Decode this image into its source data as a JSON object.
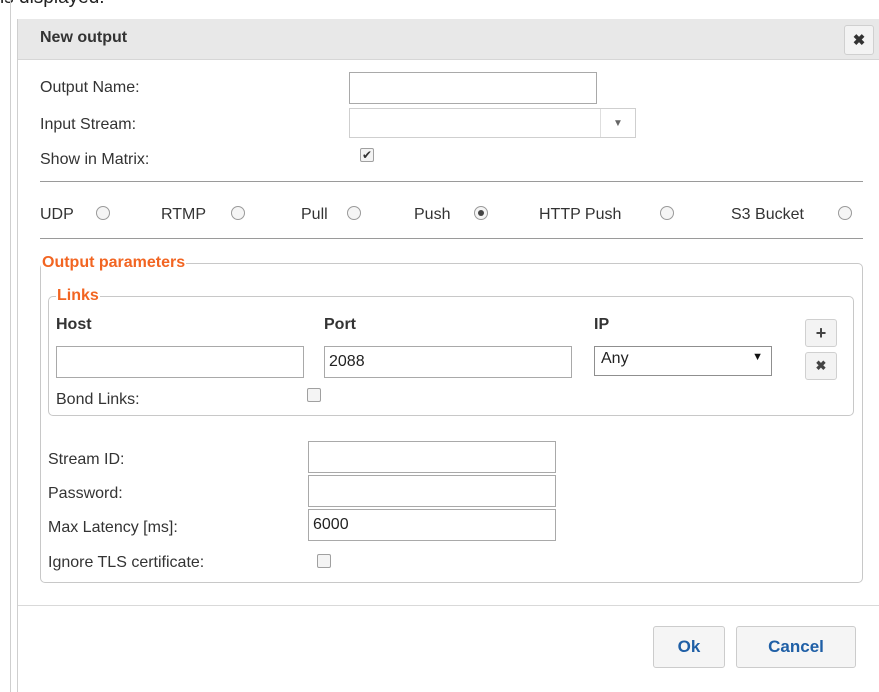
{
  "background_fragment": "is displayed:",
  "dialog": {
    "title": "New output",
    "close_icon": "close-icon"
  },
  "form": {
    "output_name_label": "Output Name:",
    "output_name_value": "",
    "input_stream_label": "Input Stream:",
    "input_stream_value": "",
    "show_in_matrix_label": "Show in Matrix:",
    "show_in_matrix_checked": true
  },
  "protocols": [
    {
      "label": "UDP",
      "selected": false
    },
    {
      "label": "RTMP",
      "selected": false
    },
    {
      "label": "Pull",
      "selected": false
    },
    {
      "label": "Push",
      "selected": true
    },
    {
      "label": "HTTP Push",
      "selected": false
    },
    {
      "label": "S3 Bucket",
      "selected": false
    }
  ],
  "output_parameters": {
    "legend": "Output parameters",
    "links": {
      "legend": "Links",
      "columns": [
        "Host",
        "Port",
        "IP"
      ],
      "row": {
        "host": "",
        "port": "2088",
        "ip": "Any"
      },
      "add_icon": "plus-icon",
      "remove_icon": "close-icon",
      "bond_links_label": "Bond Links:",
      "bond_links_checked": false
    },
    "stream_id_label": "Stream ID:",
    "stream_id_value": "",
    "password_label": "Password:",
    "password_value": "",
    "max_latency_label": "Max Latency [ms]:",
    "max_latency_value": "6000",
    "ignore_tls_label": "Ignore TLS certificate:",
    "ignore_tls_checked": false
  },
  "footer": {
    "ok_label": "Ok",
    "cancel_label": "Cancel"
  }
}
